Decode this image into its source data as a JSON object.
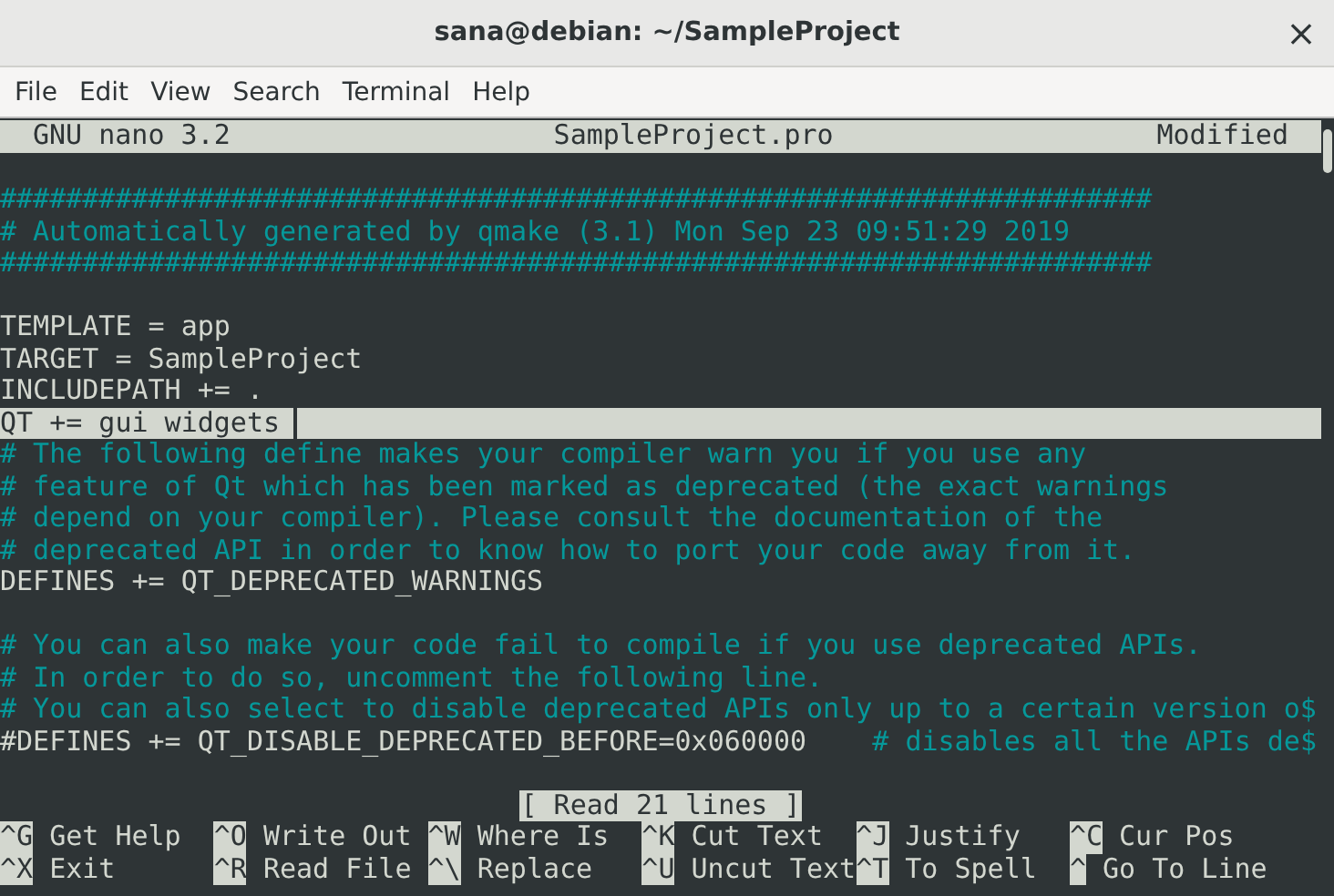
{
  "window": {
    "title": "sana@debian: ~/SampleProject",
    "close": "×"
  },
  "menu": [
    "File",
    "Edit",
    "View",
    "Search",
    "Terminal",
    "Help"
  ],
  "nano": {
    "version": "GNU nano 3.2",
    "filename": "SampleProject.pro",
    "status": "Modified",
    "lines": [
      {
        "kind": "blank"
      },
      {
        "kind": "comment",
        "text": "######################################################################"
      },
      {
        "kind": "comment",
        "text": "# Automatically generated by qmake (3.1) Mon Sep 23 09:51:29 2019"
      },
      {
        "kind": "comment",
        "text": "######################################################################"
      },
      {
        "kind": "blank"
      },
      {
        "kind": "code",
        "text": "TEMPLATE = app"
      },
      {
        "kind": "code",
        "text": "TARGET = SampleProject"
      },
      {
        "kind": "code",
        "text": "INCLUDEPATH += ."
      },
      {
        "kind": "code",
        "text": "QT += gui widgets",
        "cursor_line": true
      },
      {
        "kind": "comment",
        "text": "# The following define makes your compiler warn you if you use any"
      },
      {
        "kind": "comment",
        "text": "# feature of Qt which has been marked as deprecated (the exact warnings"
      },
      {
        "kind": "comment",
        "text": "# depend on your compiler). Please consult the documentation of the"
      },
      {
        "kind": "comment",
        "text": "# deprecated API in order to know how to port your code away from it."
      },
      {
        "kind": "code",
        "text": "DEFINES += QT_DEPRECATED_WARNINGS"
      },
      {
        "kind": "blank"
      },
      {
        "kind": "comment",
        "text": "# You can also make your code fail to compile if you use deprecated APIs."
      },
      {
        "kind": "comment",
        "text": "# In order to do so, uncomment the following line."
      },
      {
        "kind": "comment",
        "text": "# You can also select to disable deprecated APIs only up to a certain version o$"
      },
      {
        "kind": "mixed",
        "text": "#DEFINES += QT_DISABLE_DEPRECATED_BEFORE=0x060000",
        "comment": "    # disables all the APIs de$"
      },
      {
        "kind": "blank"
      }
    ],
    "message": "[ Read 21 lines ]",
    "shortcuts": [
      [
        {
          "key": "^G",
          "label": "Get Help"
        },
        {
          "key": "^O",
          "label": "Write Out"
        },
        {
          "key": "^W",
          "label": "Where Is"
        },
        {
          "key": "^K",
          "label": "Cut Text"
        },
        {
          "key": "^J",
          "label": "Justify"
        },
        {
          "key": "^C",
          "label": "Cur Pos"
        }
      ],
      [
        {
          "key": "^X",
          "label": "Exit"
        },
        {
          "key": "^R",
          "label": "Read File"
        },
        {
          "key": "^\\",
          "label": "Replace"
        },
        {
          "key": "^U",
          "label": "Uncut Text"
        },
        {
          "key": "^T",
          "label": "To Spell"
        },
        {
          "key": "^",
          "label": "Go To Line"
        }
      ]
    ]
  }
}
